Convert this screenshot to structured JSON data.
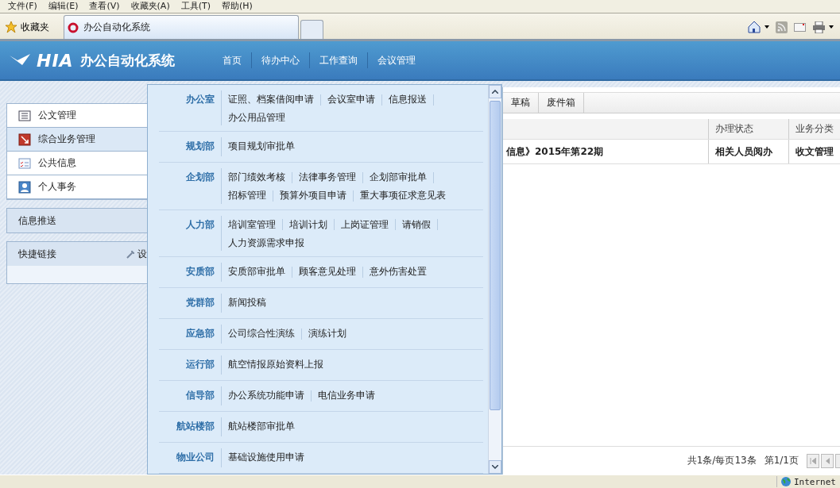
{
  "menu_bar": [
    "文件(F)",
    "编辑(E)",
    "查看(V)",
    "收藏夹(A)",
    "工具(T)",
    "帮助(H)"
  ],
  "browser": {
    "favorites": "收藏夹",
    "tab_title": "办公自动化系统"
  },
  "header": {
    "logo": "HIA",
    "title": "办公自动化系统",
    "nav": [
      "首页",
      "待办中心",
      "工作查询",
      "会议管理"
    ]
  },
  "sidebar": {
    "items": [
      {
        "label": "公文管理",
        "kind": "document",
        "selected": false
      },
      {
        "label": "综合业务管理",
        "kind": "business",
        "selected": true
      },
      {
        "label": "公共信息",
        "kind": "public",
        "selected": false
      },
      {
        "label": "个人事务",
        "kind": "person",
        "selected": false
      }
    ],
    "panels": [
      {
        "title": "信息推送"
      },
      {
        "title": "快捷链接",
        "action": "设"
      }
    ]
  },
  "dropdown": {
    "groups": [
      {
        "dept": "办公室",
        "links": [
          "证照、档案借阅申请",
          "会议室申请",
          "信息报送",
          "办公用品管理"
        ]
      },
      {
        "dept": "规划部",
        "links": [
          "项目规划审批单"
        ]
      },
      {
        "dept": "企划部",
        "links": [
          "部门绩效考核",
          "法律事务管理",
          "企划部审批单",
          "招标管理",
          "预算外项目申请",
          "重大事项征求意见表"
        ]
      },
      {
        "dept": "人力部",
        "links": [
          "培训室管理",
          "培训计划",
          "上岗证管理",
          "请销假",
          "人力资源需求申报"
        ]
      },
      {
        "dept": "安质部",
        "links": [
          "安质部审批单",
          "顾客意见处理",
          "意外伤害处置"
        ]
      },
      {
        "dept": "党群部",
        "links": [
          "新闻投稿"
        ]
      },
      {
        "dept": "应急部",
        "links": [
          "公司综合性演练",
          "演练计划"
        ]
      },
      {
        "dept": "运行部",
        "links": [
          "航空情报原始资料上报"
        ]
      },
      {
        "dept": "信导部",
        "links": [
          "办公系统功能申请",
          "电信业务申请"
        ]
      },
      {
        "dept": "航站楼部",
        "links": [
          "航站楼部审批单"
        ]
      },
      {
        "dept": "物业公司",
        "links": [
          "基础设施使用申请"
        ]
      }
    ]
  },
  "content": {
    "tabs": [
      "草稿",
      "废件箱"
    ],
    "table": {
      "columns": [
        "办理状态",
        "业务分类"
      ],
      "rows": [
        {
          "title": "信息》2015年第22期",
          "status": "相关人员阅办",
          "category": "收文管理"
        }
      ]
    },
    "pager": {
      "summary": "共1条/每页13条",
      "page": "第1/1页"
    }
  },
  "status_bar": {
    "zone": "Internet"
  }
}
